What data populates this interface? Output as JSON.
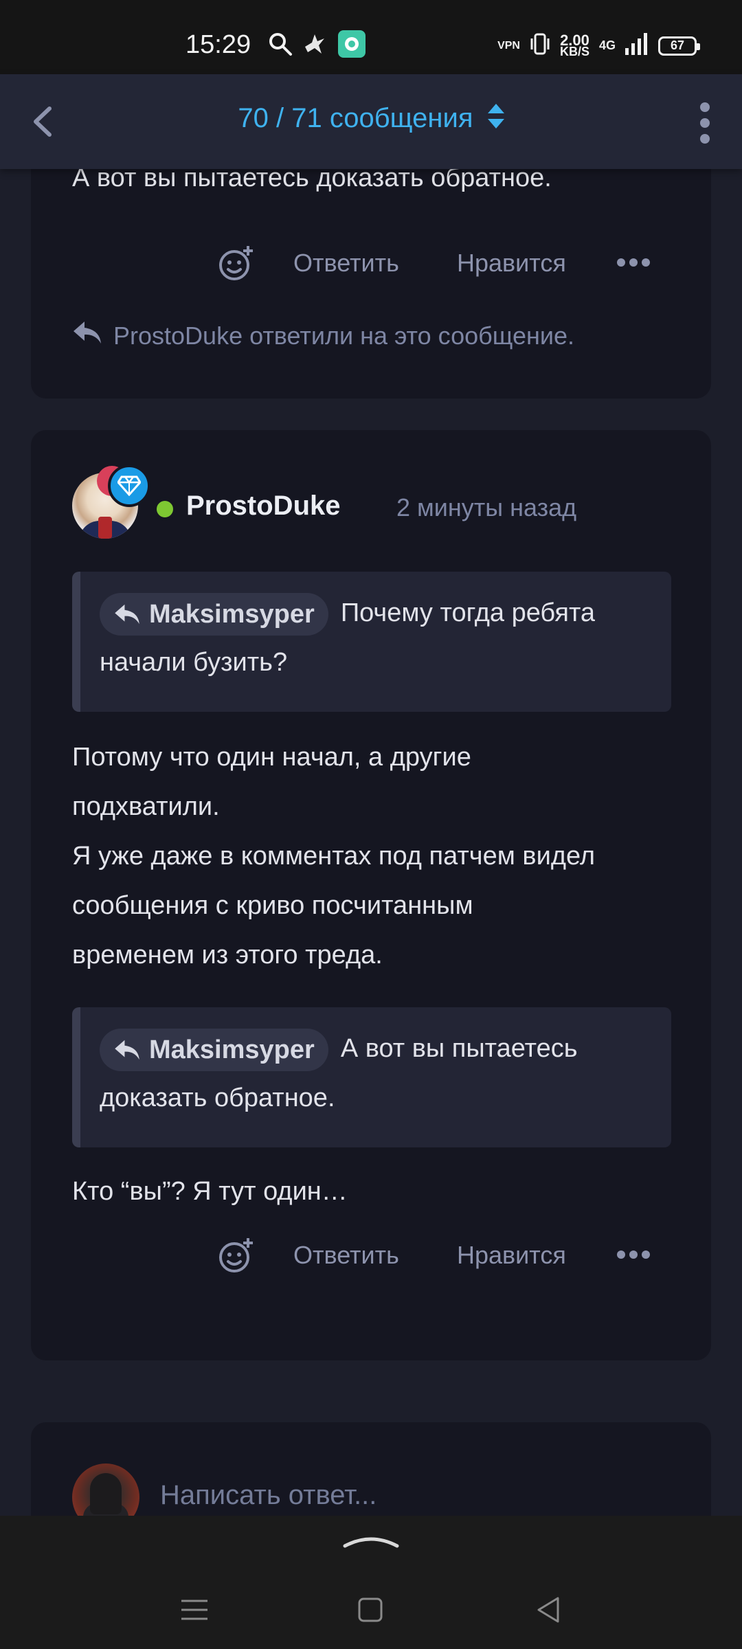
{
  "status_bar": {
    "time": "15:29",
    "net_speed_value": "2.00",
    "net_speed_unit": "KB/S",
    "network_type": "4G",
    "vpn_label": "VPN",
    "battery_level": "67"
  },
  "app_bar": {
    "title": "70 / 71 сообщения"
  },
  "prev_post": {
    "text_tail": "А вот вы пытаетесь доказать обратное.",
    "reply_label": "Ответить",
    "like_label": "Нравится",
    "replied_note": "ProstoDuke ответили на это сообщение."
  },
  "post": {
    "author": "ProstoDuke",
    "time_ago": "2 минуты назад",
    "quote1": {
      "author": "Maksimsyper",
      "text": "Почему тогда ребята начали бузить?"
    },
    "body1": [
      "Потому что один начал, а другие",
      "подхватили.",
      "Я уже даже в комментах под патчем видел",
      "сообщения с криво посчитанным",
      "временем из этого треда."
    ],
    "quote2": {
      "author": "Maksimsyper",
      "text": "А вот вы пытаетесь доказать обратное."
    },
    "body2": "Кто “вы”? Я тут один…",
    "reply_label": "Ответить",
    "like_label": "Нравится"
  },
  "reply_box": {
    "placeholder": "Написать ответ..."
  },
  "colors": {
    "accent": "#3fb2ef",
    "online": "#7ec832",
    "background": "#1c1e2a",
    "card": "#151621"
  }
}
